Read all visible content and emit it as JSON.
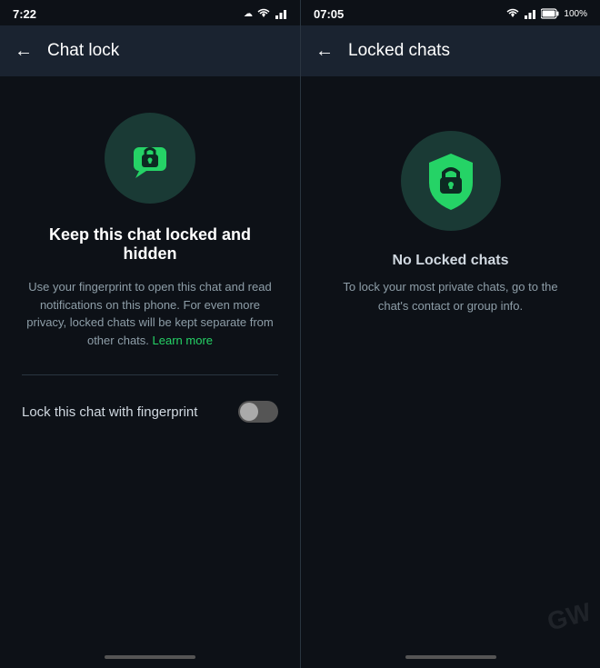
{
  "left": {
    "statusBar": {
      "time": "7:22",
      "cloudIcon": "☁",
      "wifiIcon": "▾",
      "signalIcon": "▲▲"
    },
    "header": {
      "backLabel": "←",
      "title": "Chat lock"
    },
    "icon": {
      "name": "chat-lock-icon"
    },
    "mainTitle": "Keep this chat locked and hidden",
    "description": "Use your fingerprint to open this chat and read notifications on this phone. For even more privacy, locked chats will be kept separate from other chats.",
    "learnMore": "Learn more",
    "toggleLabel": "Lock this chat with fingerprint",
    "toggleState": false
  },
  "right": {
    "statusBar": {
      "time": "07:05",
      "wifiIcon": "wifi",
      "signalIcon": "▲▲",
      "batteryIcon": "battery",
      "batteryPercent": "100%"
    },
    "header": {
      "backLabel": "←",
      "title": "Locked chats"
    },
    "noLockedTitle": "No Locked chats",
    "noLockedDesc": "To lock your most private chats, go to the chat's contact or group info."
  },
  "colors": {
    "accent": "#25d366",
    "background": "#0d1117",
    "headerBg": "#1a2330",
    "iconCircleBg": "#1a3a35",
    "textPrimary": "#ffffff",
    "textSecondary": "#8e9ea8",
    "textBody": "#d0d8e0"
  }
}
